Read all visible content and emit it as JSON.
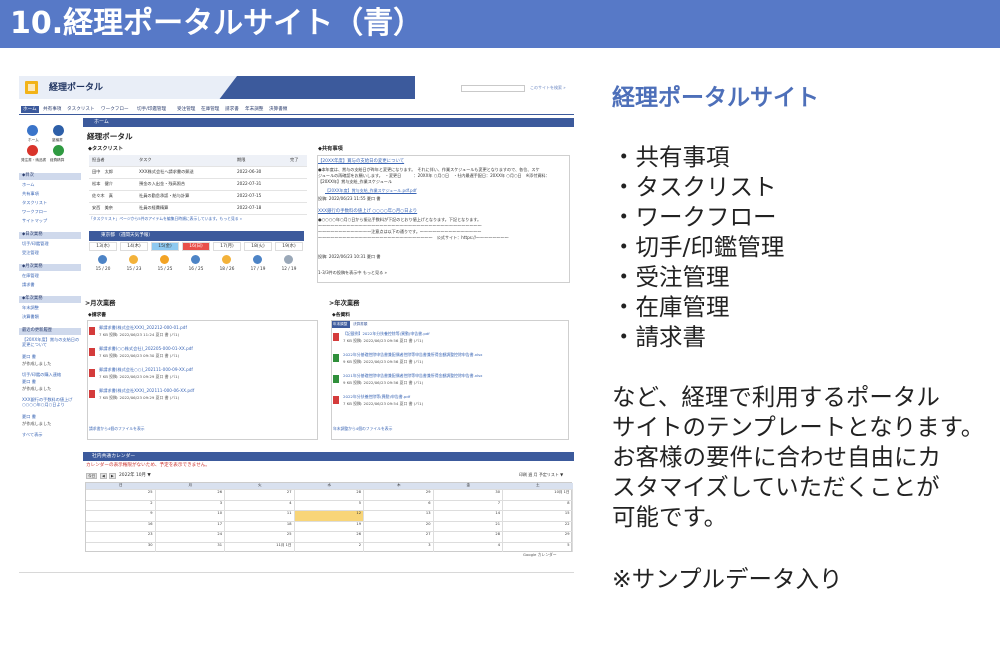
{
  "slide": {
    "title": "10.経理ポータルサイト（青）"
  },
  "portal": {
    "header": {
      "title": "経理ポータル",
      "search_link": "このサイトを検索 »"
    },
    "nav": [
      "ホーム",
      "共有事項",
      "タスクリスト",
      "ワークフロー",
      "切手/印鑑管理",
      "受注管理",
      "在庫管理",
      "請求書",
      "年末調整",
      "決算書類"
    ],
    "quick_icons": [
      {
        "label": "ホーム"
      },
      {
        "label": "稟議書"
      },
      {
        "label": "発注書・納品書"
      },
      {
        "label": "経費精算"
      }
    ],
    "sidebar": [
      {
        "head": "◆目次",
        "links": [
          "ホーム",
          "共有事項",
          "タスクリスト",
          "ワークフロー",
          "サイトマップ"
        ]
      },
      {
        "head": "◆日次業務",
        "links": [
          "切手/印鑑管理",
          "受注管理"
        ]
      },
      {
        "head": "◆月次業務",
        "links": [
          "在庫管理",
          "請求書"
        ]
      },
      {
        "head": "◆年次業務",
        "links": [
          "年末調整",
          "決算書類"
        ]
      },
      {
        "head": "最近の更新履歴",
        "links": [
          "【20XX年度】賞与の支給日の変更について",
          "夏口 書",
          "が作成しました",
          "切手/印鑑の購入連絡",
          "夏口 書",
          "が作成しました",
          "XXX銀行の手数料の値上げ ○○○○年○月○日より",
          "夏口 書",
          "が作成しました",
          "すべて表示"
        ]
      }
    ],
    "home_bar": "ホーム",
    "page_title": "経理ポータル",
    "tasklist": {
      "title": "◆タスクリスト",
      "columns": [
        "担当者",
        "タスク",
        "期限",
        "完了"
      ],
      "rows": [
        [
          "田中　太郎",
          "XXX株式会社へ請求書の郵送",
          "2022-06-30",
          ""
        ],
        [
          "松本　健介",
          "預金の入出金・残高照合",
          "2022-07-31",
          ""
        ],
        [
          "佐々木　真",
          "社員の勤怠承認・給与計算",
          "2022-07-15",
          ""
        ],
        [
          "安西　美奈",
          "社員の経費精算",
          "2022-07-18",
          ""
        ]
      ],
      "note": "「タスクリスト」ページから5件のアイテムを編集日時順に表示しています。もっと見る »"
    },
    "weather": {
      "title": "東京都 （週間天気予報）",
      "days": [
        {
          "day": "13(水)",
          "temp": "15 / 20",
          "mark": "rain"
        },
        {
          "day": "14(木)",
          "temp": "15 / 23",
          "mark": "cloud"
        },
        {
          "day": "15(金)",
          "temp": "15 / 25",
          "mark": "sun"
        },
        {
          "day": "16(日)",
          "temp": "16 / 25",
          "mark": "rain"
        },
        {
          "day": "17(月)",
          "temp": "18 / 26",
          "mark": "cloud"
        },
        {
          "day": "18(火)",
          "temp": "17 / 19",
          "mark": "rain"
        },
        {
          "day": "19(水)",
          "temp": "12 / 19",
          "mark": "cloud"
        }
      ]
    },
    "shared": {
      "title": "◆共有事項",
      "notice1_title": "【20XX年度】賞与の支給日の変更について",
      "notice1_lines": [
        "●本年度は、賞与の支給日が昨年と変更になります。　それに伴い、作業スケジュールも変更となりますので、各位、スケ",
        "ジュールの再確認をお願いします。　・変更日　　　：20XX年 ○月○日　・社内最遅手配日：20XX年 ○月○日　※添付資料：",
        "【20XX年】賞与支給_作業スケジュール"
      ],
      "notice1_file": "【20XX年度】賞与支給_作業スケジュール.pdf.pdf",
      "notice1_meta": "投稿: 2022/06/23 11:55 夏口 書",
      "notice2_title": "XXX銀行の手数料の値上げ ○○○○年○月○日より",
      "notice2_lines": [
        "●○○○○年○月○日から振込手数料が下記のとおり値上げとなります。下記となります。",
        "～～～～～～～～～～～～～～～～～～～～～～～～～～～～～～～～～～～～～～～～",
        "～～～～～～～～～～～～～注意点は以下の通りです。～～～～～～～～～～～～～～～",
        "～～～～～～～～～～～～～～～～～～～～～～～～～～～～　公式サイト：https://～～～～～～～～"
      ],
      "notice2_meta": "投稿: 2022/06/23 10:31 夏口 書",
      "footer": "1-3/3件の投稿を表示中 もっと見る »"
    },
    "monthly": {
      "section": ">月次業務",
      "sub": "◆請求書",
      "files": [
        {
          "name": "郵請求書(株式会社XXX)_202212-000-01.pdf",
          "meta": "7 KB  投稿: 2022/06/23 11:24 夏口 書 (バ1)"
        },
        {
          "name": "郵請求書(○○株式会社)_202205-000-01-XX.pdf",
          "meta": "7 KB  投稿: 2022/06/23 09:30 夏口 書 (バ1)"
        },
        {
          "name": "郵請求書(株式会社○○)_202111-000-09-XX.pdf",
          "meta": "7 KB  投稿: 2022/06/23 09:29 夏口 書 (バ1)"
        },
        {
          "name": "郵請求書(株式会社XXX)_202111-000-06-XX.pdf",
          "meta": "7 KB  投稿: 2022/06/23 09:29 夏口 書 (バ1)"
        }
      ],
      "footer": "請求書から4個のファイルを表示"
    },
    "yearly": {
      "section": ">年次業務",
      "sub": "◆各資料",
      "tabs": [
        "年末調整",
        "決算書類"
      ],
      "files": [
        {
          "name": "【記載例】2022年分扶養控除等(異動)申告書.pdf",
          "meta": "7 KB  投稿: 2022/06/23 09:56 夏口 書 (バ1)",
          "kind": "pdf"
        },
        {
          "name": "2022年分基礎控除申告書兼配偶者控除等申告書兼所得金額調整控除申告書.xlsx",
          "meta": "9 KB  投稿: 2022/06/23 09:56 夏口 書 (バ1)",
          "kind": "xlsx"
        },
        {
          "name": "2021年分基礎控除申告書兼配偶者控除等申告書兼所得金額調整控除申告書.xlsx",
          "meta": "9 KB  投稿: 2022/06/23 09:56 夏口 書 (バ1)",
          "kind": "xlsx"
        },
        {
          "name": "2022年分扶養控除等(異動)申告書.pdf",
          "meta": "7 KB  投稿: 2022/06/23 09:54 夏口 書 (バ1)",
          "kind": "pdf"
        }
      ],
      "footer": "年末調整から4個のファイルを表示"
    },
    "calendar": {
      "title": "社内共通カレンダー",
      "error": "カレンダーの表示権限がないため、予定を表示できません。",
      "today_btn": "今日",
      "month": "2022年 10月 ▼",
      "right_controls": "印刷  週  月  予定リスト ▼",
      "dow": [
        "日",
        "月",
        "火",
        "水",
        "木",
        "金",
        "土"
      ],
      "weeks": [
        [
          "25",
          "26",
          "27",
          "28",
          "29",
          "30",
          "10月 1日"
        ],
        [
          "2",
          "3",
          "4",
          "5",
          "6",
          "7",
          "8"
        ],
        [
          "9",
          "10",
          "11",
          "12",
          "13",
          "14",
          "15"
        ],
        [
          "16",
          "17",
          "18",
          "19",
          "20",
          "21",
          "22"
        ],
        [
          "23",
          "24",
          "25",
          "26",
          "27",
          "28",
          "29"
        ],
        [
          "30",
          "31",
          "11月 1日",
          "2",
          "3",
          "4",
          "5"
        ]
      ],
      "footer": "Google カレンダー"
    }
  },
  "right": {
    "title": "経理ポータルサイト",
    "items": [
      "・共有事項",
      "・タスクリスト",
      "・ワークフロー",
      "・切手/印鑑管理",
      "・受注管理",
      "・在庫管理",
      "・請求書"
    ],
    "desc": [
      "など、経理で利用するポータル",
      "サイトのテンプレートとなります。",
      "お客様の要件に合わせ自由にカ",
      "スタマイズしていただくことが",
      "可能です。"
    ],
    "note": "※サンプルデータ入り"
  }
}
